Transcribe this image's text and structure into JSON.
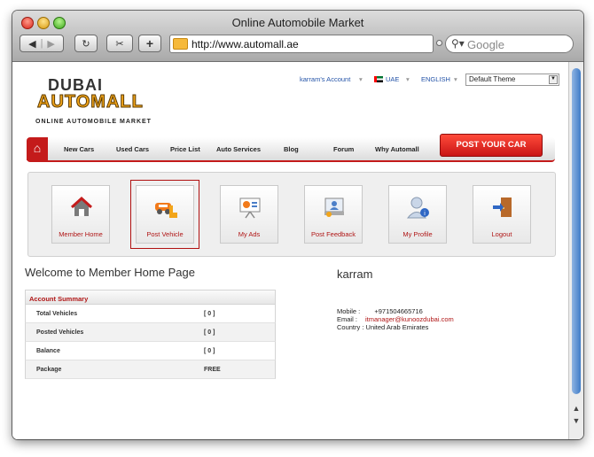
{
  "window": {
    "title": "Online Automobile Market"
  },
  "toolbar": {
    "url": "http://www.automall.ae",
    "search_placeholder": "Google"
  },
  "site": {
    "logo": {
      "top": "DUBAI",
      "main": "AUTOMALL",
      "tagline": "ONLINE AUTOMOBILE MARKET"
    },
    "top_links": {
      "account": "karram's Account",
      "country": "UAE",
      "language": "ENGLISH"
    },
    "theme_select": {
      "value": "Default Theme"
    },
    "nav": {
      "items": [
        "New Cars",
        "Used Cars",
        "Price List",
        "Auto Services",
        "Blog",
        "Forum",
        "Why Automall"
      ],
      "post_car": "POST YOUR CAR"
    },
    "menu": [
      {
        "label": "Member Home",
        "icon": "house-icon"
      },
      {
        "label": "Post Vehicle",
        "icon": "post-vehicle-icon",
        "active": true
      },
      {
        "label": "My Ads",
        "icon": "presentation-icon"
      },
      {
        "label": "Post Feedback",
        "icon": "feedback-icon"
      },
      {
        "label": "My Profile",
        "icon": "profile-icon"
      },
      {
        "label": "Logout",
        "icon": "door-icon"
      }
    ],
    "welcome": "Welcome to Member Home Page",
    "summary": {
      "title": "Account Summary",
      "rows": [
        {
          "label": "Total Vehicles",
          "value": "[ 0 ]"
        },
        {
          "label": "Posted Vehicles",
          "value": "[ 0 ]"
        },
        {
          "label": "Balance",
          "value": "[ 0 ]"
        },
        {
          "label": "Package",
          "value": "FREE"
        }
      ]
    },
    "profile": {
      "name": "karram",
      "mobile_label": "Mobile :",
      "mobile": "+971504665716",
      "email_label": "Email :",
      "email": "itmanager@kunoozdubai.com",
      "country_label": "Country :",
      "country": "United Arab Emirates"
    }
  },
  "colors": {
    "brand_red": "#c41b1b",
    "link_blue": "#2554a8",
    "logo_gold": "#f2a51a"
  }
}
